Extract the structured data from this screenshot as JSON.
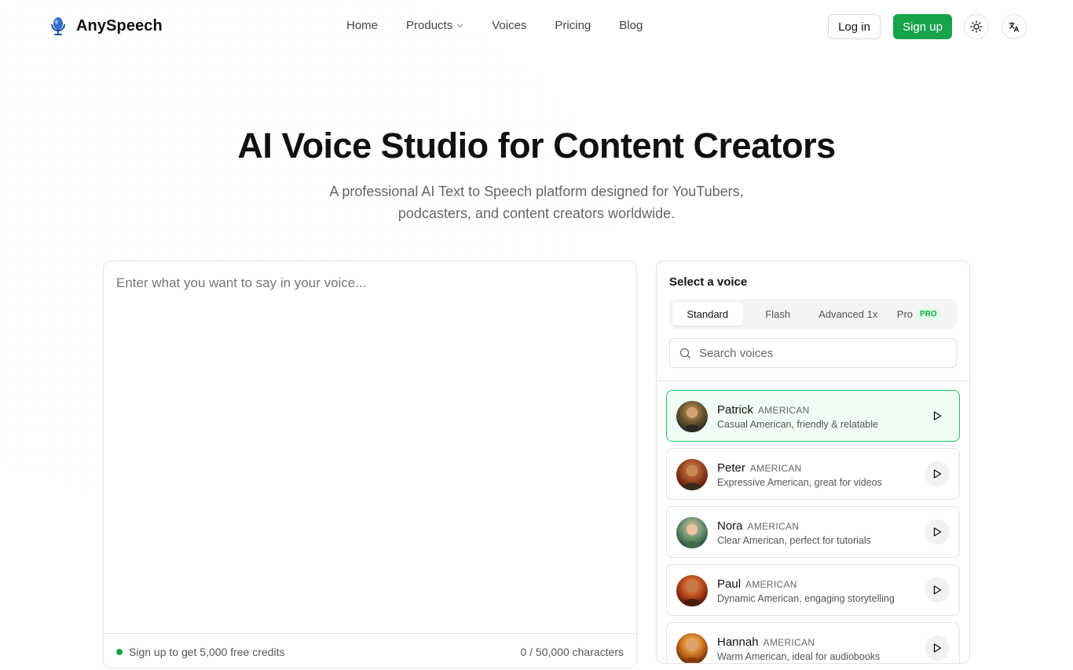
{
  "brand": {
    "name": "AnySpeech"
  },
  "nav": {
    "items": [
      {
        "label": "Home"
      },
      {
        "label": "Products"
      },
      {
        "label": "Voices"
      },
      {
        "label": "Pricing"
      },
      {
        "label": "Blog"
      }
    ]
  },
  "header": {
    "login_label": "Log in",
    "signup_label": "Sign up"
  },
  "hero": {
    "title": "AI Voice Studio for Content Creators",
    "subtitle": "A professional AI Text to Speech platform designed for YouTubers, podcasters, and content creators worldwide."
  },
  "editor": {
    "placeholder": "Enter what you want to say in your voice...",
    "value": "",
    "credits_note": "Sign up to get 5,000 free credits",
    "char_count": "0 / 50,000 characters"
  },
  "voice_panel": {
    "title": "Select a voice",
    "tabs": [
      {
        "label": "Standard",
        "active": true
      },
      {
        "label": "Flash"
      },
      {
        "label": "Advanced 1x"
      },
      {
        "label": "Pro",
        "badge": "PRO"
      }
    ],
    "search_placeholder": "Search voices",
    "voices": [
      {
        "name": "Patrick",
        "accent": "AMERICAN",
        "description": "Casual American, friendly & relatable",
        "selected": true
      },
      {
        "name": "Peter",
        "accent": "AMERICAN",
        "description": "Expressive American, great for videos"
      },
      {
        "name": "Nora",
        "accent": "AMERICAN",
        "description": "Clear American, perfect for tutorials"
      },
      {
        "name": "Paul",
        "accent": "AMERICAN",
        "description": "Dynamic American, engaging storytelling"
      },
      {
        "name": "Hannah",
        "accent": "AMERICAN",
        "description": "Warm American, ideal for audiobooks"
      }
    ]
  },
  "colors": {
    "accent": "#16a34a",
    "selected_border": "#22c55e",
    "selected_bg": "#f0fdf4"
  }
}
